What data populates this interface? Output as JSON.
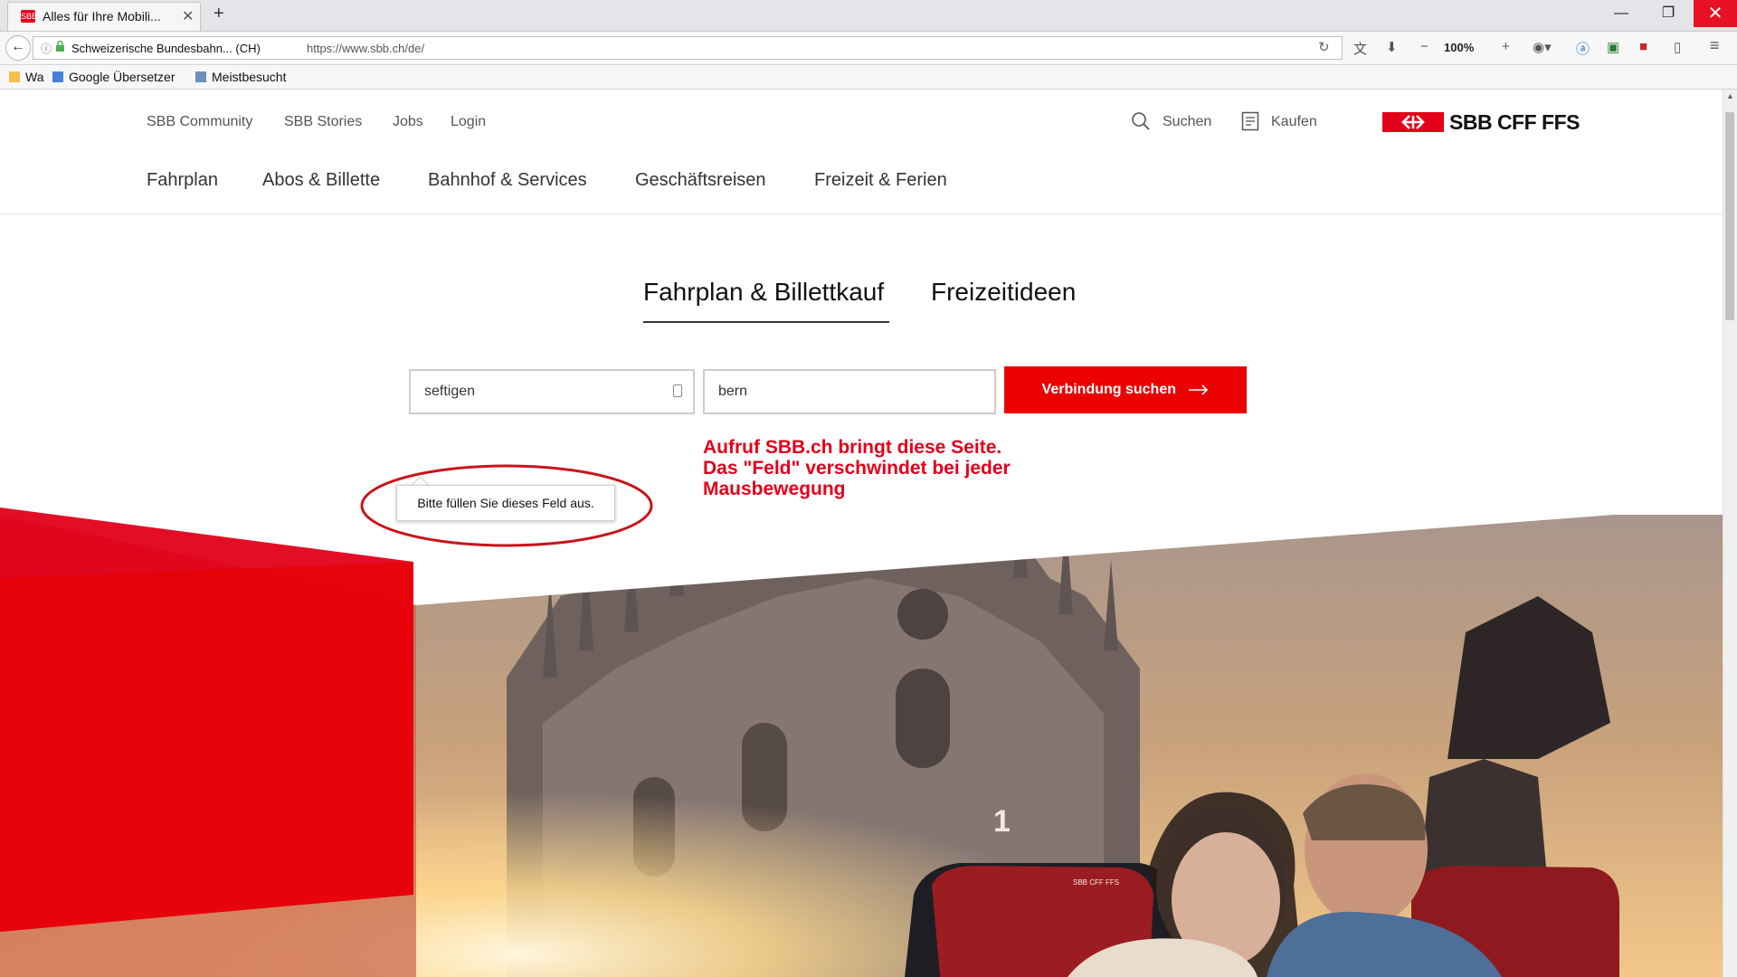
{
  "browser": {
    "tab_title": "Alles für Ihre Mobili...",
    "tab_favicon_text": "SBB",
    "tab_close": "✕",
    "new_tab": "+",
    "window_controls": {
      "minimize": "—",
      "maximize": "❐",
      "close": "✕"
    },
    "site_identity": "Schweizerische Bundesbahn... (CH)",
    "url": "https://www.sbb.ch/de/",
    "zoom": "100%",
    "bookmarks": [
      "Wa",
      "Google Übersetzer",
      "Meistbesucht"
    ]
  },
  "header": {
    "meta_nav": [
      "SBB Community",
      "SBB Stories",
      "Jobs",
      "Login"
    ],
    "search_label": "Suchen",
    "buy_label": "Kaufen",
    "logo_text": "SBB CFF FFS",
    "main_nav": [
      "Fahrplan",
      "Abos & Billette",
      "Bahnhof & Services",
      "Geschäftsreisen",
      "Freizeit & Ferien"
    ]
  },
  "planner": {
    "tabs": [
      "Fahrplan & Billettkauf",
      "Freizeitideen"
    ],
    "from_value": "seftigen",
    "to_value": "bern",
    "search_button": "Verbindung suchen",
    "tooltip": "Bitte füllen Sie dieses Feld aus."
  },
  "annotation": {
    "lines": [
      "Aufruf SBB.ch bringt diese Seite.",
      "Das \"Feld\" verschwindet bei jeder",
      "Mausbewegung"
    ]
  },
  "hero": {
    "seat_number": "1",
    "seat_logo": "SBB CFF FFS"
  },
  "colors": {
    "brand_red": "#eb0000",
    "annotation_red": "#e2001a"
  }
}
